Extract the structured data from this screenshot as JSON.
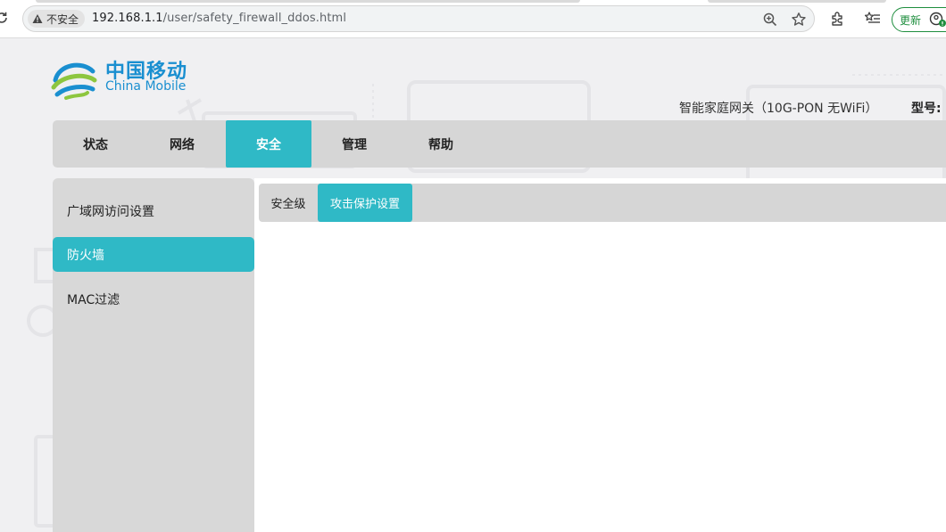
{
  "browser": {
    "security_label": "不安全",
    "url_host": "192.168.1.1",
    "url_path": "/user/safety_firewall_ddos.html",
    "update_label": "更新",
    "icons": [
      "reload-icon",
      "warning-icon",
      "zoom-icon",
      "bookmark-star-icon",
      "extensions-icon",
      "reading-list-icon",
      "profile-icon"
    ]
  },
  "header": {
    "logo_cn": "中国移动",
    "logo_en": "China Mobile",
    "device_info": "智能家庭网关（10G-PON 无WiFi）",
    "model_label": "型号:"
  },
  "main_nav": {
    "items": [
      {
        "label": "状态"
      },
      {
        "label": "网络"
      },
      {
        "label": "安全"
      },
      {
        "label": "管理"
      },
      {
        "label": "帮助"
      }
    ],
    "active": "安全"
  },
  "sidebar": {
    "items": [
      {
        "label": "广域网访问设置"
      },
      {
        "label": "防火墙"
      },
      {
        "label": "MAC过滤"
      }
    ],
    "active": "防火墙"
  },
  "sub_tabs": {
    "items": [
      {
        "label": "安全级"
      },
      {
        "label": "攻击保护设置"
      }
    ],
    "active": "攻击保护设置"
  },
  "colors": {
    "accent": "#2fb9c6",
    "brand_blue": "#1a8fd0",
    "brand_green": "#8dc63f",
    "nav_gray": "#d6d6d6"
  }
}
